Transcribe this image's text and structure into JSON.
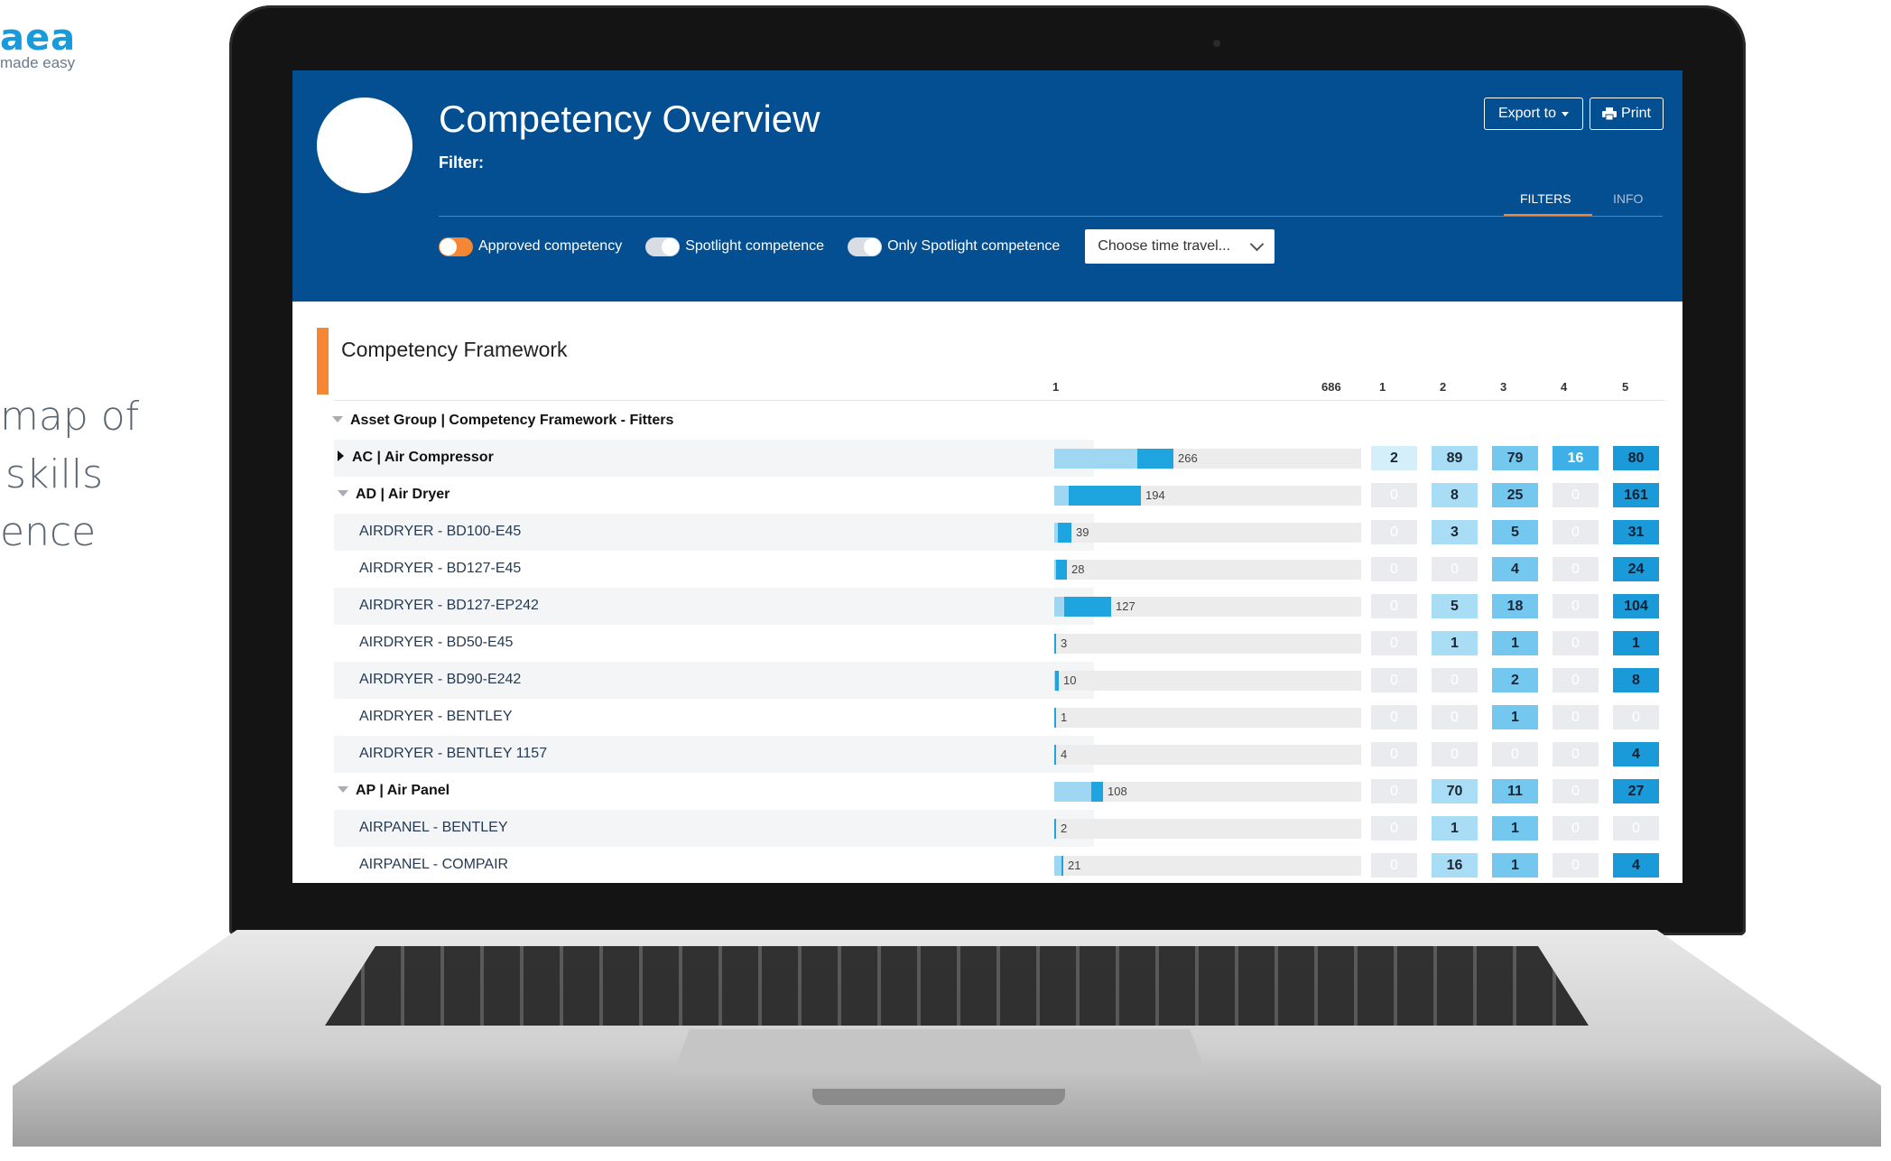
{
  "brand": {
    "logo": "aea",
    "tagline": "made easy"
  },
  "marketing": {
    "lines": [
      "map of",
      "skills",
      "ence"
    ]
  },
  "app": {
    "title": "Competency Overview",
    "filter_label": "Filter:",
    "export_label": "Export to",
    "print_label": "Print",
    "tabs": [
      {
        "label": "FILTERS",
        "active": true
      },
      {
        "label": "INFO",
        "active": false
      }
    ],
    "toggles": [
      {
        "label": "Approved competency",
        "on": true
      },
      {
        "label": "Spotlight competence",
        "on": false
      },
      {
        "label": "Only Spotlight competence",
        "on": false
      }
    ],
    "time_travel_placeholder": "Choose time travel..."
  },
  "framework": {
    "title": "Competency Framework",
    "scale_min": "1",
    "scale_max": "686",
    "level_headers": [
      "1",
      "2",
      "3",
      "4",
      "5"
    ],
    "group_label": "Asset Group | Competency Framework - Fitters",
    "rows": [
      {
        "label": "AC | Air Compressor",
        "type": "category-collapsed",
        "total": 266,
        "counts": [
          2,
          89,
          79,
          16,
          80
        ]
      },
      {
        "label": "AD | Air Dryer",
        "type": "category-expanded",
        "total": 194,
        "counts": [
          0,
          8,
          25,
          0,
          161
        ]
      },
      {
        "label": "AIRDRYER - BD100-E45",
        "type": "item",
        "total": 39,
        "counts": [
          0,
          3,
          5,
          0,
          31
        ]
      },
      {
        "label": "AIRDRYER - BD127-E45",
        "type": "item",
        "total": 28,
        "counts": [
          0,
          0,
          4,
          0,
          24
        ]
      },
      {
        "label": "AIRDRYER - BD127-EP242",
        "type": "item",
        "total": 127,
        "counts": [
          0,
          5,
          18,
          0,
          104
        ]
      },
      {
        "label": "AIRDRYER - BD50-E45",
        "type": "item",
        "total": 3,
        "counts": [
          0,
          1,
          1,
          0,
          1
        ]
      },
      {
        "label": "AIRDRYER - BD90-E242",
        "type": "item",
        "total": 10,
        "counts": [
          0,
          0,
          2,
          0,
          8
        ]
      },
      {
        "label": "AIRDRYER - BENTLEY",
        "type": "item",
        "total": 1,
        "counts": [
          0,
          0,
          1,
          0,
          0
        ]
      },
      {
        "label": "AIRDRYER - BENTLEY 1157",
        "type": "item",
        "total": 4,
        "counts": [
          0,
          0,
          0,
          0,
          4
        ]
      },
      {
        "label": "AP | Air Panel",
        "type": "category-expanded",
        "total": 108,
        "counts": [
          0,
          70,
          11,
          0,
          27
        ]
      },
      {
        "label": "AIRPANEL - BENTLEY",
        "type": "item",
        "total": 2,
        "counts": [
          0,
          1,
          1,
          0,
          0
        ]
      },
      {
        "label": "AIRPANEL - COMPAIR",
        "type": "item",
        "total": 21,
        "counts": [
          0,
          16,
          1,
          0,
          4
        ]
      }
    ]
  },
  "colors": {
    "header_bg": "#034f92",
    "accent": "#f58634",
    "level_colors": [
      "#d4eefa",
      "#a9dcf5",
      "#74c7ef",
      "#3fb0e7",
      "#1a9ad9"
    ],
    "zero_cell": "#e9ebee",
    "bar_dark": "#1ea5e0",
    "bar_light": "#9fd6f2"
  }
}
